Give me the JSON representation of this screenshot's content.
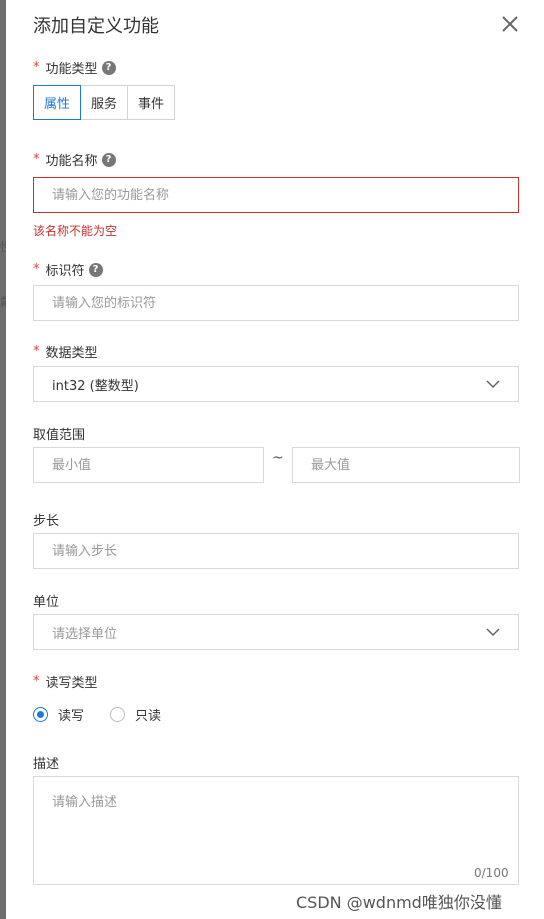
{
  "dialog": {
    "title": "添加自定义功能",
    "close_label": "×"
  },
  "background_fragments": [
    "性",
    "戴"
  ],
  "feature_type": {
    "label": "功能类型",
    "required": "*",
    "help": "?",
    "options": [
      "属性",
      "服务",
      "事件"
    ],
    "selected": "属性"
  },
  "feature_name": {
    "label": "功能名称",
    "required": "*",
    "help": "?",
    "placeholder": "请输入您的功能名称",
    "value": "",
    "error": "该名称不能为空"
  },
  "identifier": {
    "label": "标识符",
    "required": "*",
    "help": "?",
    "placeholder": "请输入您的标识符",
    "value": ""
  },
  "data_type": {
    "label": "数据类型",
    "required": "*",
    "value": "int32 (整数型)"
  },
  "value_range": {
    "label": "取值范围",
    "min_placeholder": "最小值",
    "max_placeholder": "最大值",
    "separator": "~"
  },
  "step": {
    "label": "步长",
    "placeholder": "请输入步长"
  },
  "unit": {
    "label": "单位",
    "placeholder": "请选择单位"
  },
  "rw_type": {
    "label": "读写类型",
    "required": "*",
    "options": [
      "读写",
      "只读"
    ],
    "selected": "读写"
  },
  "description": {
    "label": "描述",
    "placeholder": "请输入描述",
    "counter": "0/100"
  },
  "watermark": "CSDN @wdnmd唯独你没懂",
  "colors": {
    "accent": "#1d7ad3",
    "error": "#c9302c",
    "required": "#e8403a"
  }
}
